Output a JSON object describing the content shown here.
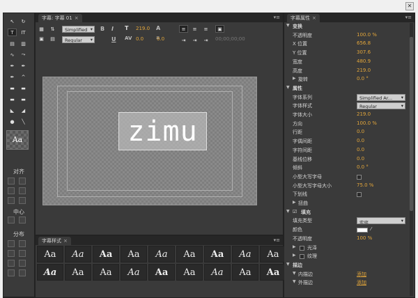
{
  "window": {
    "close": "✕"
  },
  "tools_panel": {
    "tools": [
      {
        "name": "selection-tool-icon",
        "glyph": "↖"
      },
      {
        "name": "rotation-tool-icon",
        "glyph": "↻"
      },
      {
        "name": "type-tool-icon",
        "glyph": "T"
      },
      {
        "name": "vertical-type-tool-icon",
        "glyph": "IT"
      },
      {
        "name": "area-type-tool-icon",
        "glyph": "▤"
      },
      {
        "name": "vertical-area-type-tool-icon",
        "glyph": "▥"
      },
      {
        "name": "path-type-tool-icon",
        "glyph": "∿"
      },
      {
        "name": "vertical-path-type-tool-icon",
        "glyph": "⤳"
      },
      {
        "name": "pen-tool-icon",
        "glyph": "✒"
      },
      {
        "name": "delete-anchor-tool-icon",
        "glyph": "✒"
      },
      {
        "name": "add-anchor-tool-icon",
        "glyph": "✒"
      },
      {
        "name": "convert-anchor-tool-icon",
        "glyph": "^"
      },
      {
        "name": "rectangle-tool-icon",
        "glyph": "▬"
      },
      {
        "name": "clipped-rectangle-tool-icon",
        "glyph": "▬"
      },
      {
        "name": "rounded-rectangle-tool-icon",
        "glyph": "▬"
      },
      {
        "name": "rounded-corner-rectangle-tool-icon",
        "glyph": "▬"
      },
      {
        "name": "wedge-tool-icon",
        "glyph": "◣"
      },
      {
        "name": "arc-tool-icon",
        "glyph": "◢"
      },
      {
        "name": "ellipse-tool-icon",
        "glyph": "●"
      },
      {
        "name": "line-tool-icon",
        "glyph": "╲"
      }
    ],
    "swatch_label": "Aa",
    "align_label": "对齐",
    "center_label": "中心",
    "distribute_label": "分布"
  },
  "title_panel": {
    "tab_label": "字幕: 字幕 01",
    "font_family": "Simplified",
    "font_style": "Regular",
    "font_size": "219.0",
    "kerning": "0.0",
    "leading": "0.0",
    "timecode": "00;00;00;00",
    "title_text": "zimu"
  },
  "styles_panel": {
    "tab_label": "字幕样式",
    "cells": [
      "Aa",
      "Aa",
      "Aa",
      "Aa",
      "Aa",
      "Aa",
      "Aa",
      "Aa",
      "Aa",
      "Aa",
      "Aa",
      "Aa",
      "Aa",
      "Aa",
      "Aa",
      "Aa",
      "Aa",
      "Aa",
      "Aa",
      "AA"
    ]
  },
  "props_panel": {
    "tab_label": "字幕属性",
    "rows": [
      {
        "type": "section",
        "label": "变换"
      },
      {
        "type": "value",
        "label": "不透明度",
        "value": "100.0 %"
      },
      {
        "type": "value",
        "label": "X 位置",
        "value": "656.8"
      },
      {
        "type": "value",
        "label": "Y 位置",
        "value": "307.6"
      },
      {
        "type": "value",
        "label": "宽度",
        "value": "480.9"
      },
      {
        "type": "value",
        "label": "高度",
        "value": "219.0"
      },
      {
        "type": "value",
        "label": "旋转",
        "value": "0.0 °",
        "twist": true
      },
      {
        "type": "section",
        "label": "属性"
      },
      {
        "type": "dropdown",
        "label": "字体系列",
        "value": "Simplified Ar..."
      },
      {
        "type": "dropdown",
        "label": "字体样式",
        "value": "Regular"
      },
      {
        "type": "value",
        "label": "字体大小",
        "value": "219.0"
      },
      {
        "type": "value",
        "label": "方向",
        "value": "100.0 %"
      },
      {
        "type": "value",
        "label": "行距",
        "value": "0.0"
      },
      {
        "type": "value",
        "label": "字偶间距",
        "value": "0.0"
      },
      {
        "type": "value",
        "label": "字符间距",
        "value": "0.0"
      },
      {
        "type": "value",
        "label": "基线位移",
        "value": "0.0"
      },
      {
        "type": "value",
        "label": "倾斜",
        "value": "0.0 °"
      },
      {
        "type": "check",
        "label": "小型大写字母"
      },
      {
        "type": "value",
        "label": "小型大写字母大小",
        "value": "75.0 %"
      },
      {
        "type": "check",
        "label": "下划线"
      },
      {
        "type": "twist",
        "label": "扭曲"
      },
      {
        "type": "section",
        "label": "填充",
        "checked": true
      },
      {
        "type": "dropdown",
        "label": "填充类型",
        "value": "实底"
      },
      {
        "type": "color",
        "label": "颜色"
      },
      {
        "type": "value",
        "label": "不透明度",
        "value": "100 %"
      },
      {
        "type": "twistcheck",
        "label": "光泽"
      },
      {
        "type": "twistcheck",
        "label": "纹理"
      },
      {
        "type": "section",
        "label": "描边"
      },
      {
        "type": "link",
        "label": "内描边",
        "value": "添加",
        "twist": true
      },
      {
        "type": "link",
        "label": "外描边",
        "value": "添加",
        "twist": true
      }
    ]
  },
  "colors": {
    "accent": "#e3a63a",
    "panel_bg": "#3a3a3a"
  }
}
